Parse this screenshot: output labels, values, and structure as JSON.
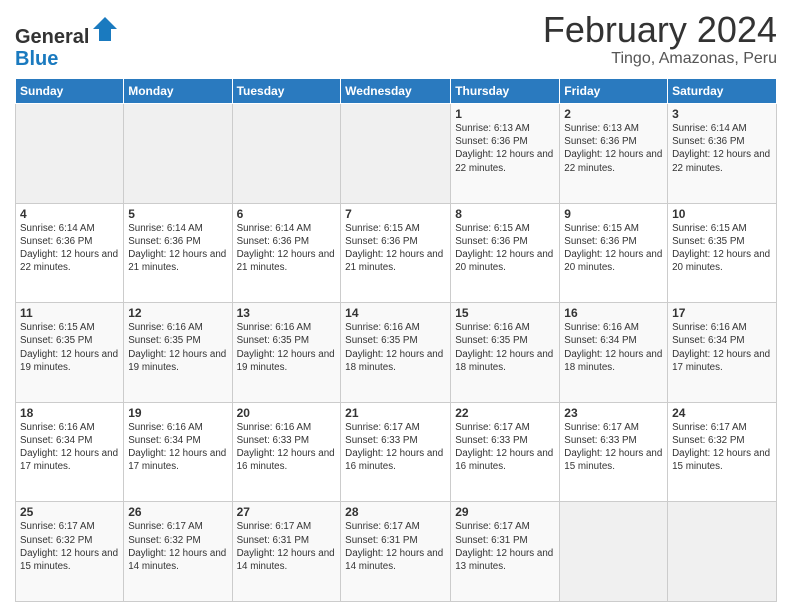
{
  "header": {
    "logo_general": "General",
    "logo_blue": "Blue",
    "title": "February 2024",
    "subtitle": "Tingo, Amazonas, Peru"
  },
  "days_of_week": [
    "Sunday",
    "Monday",
    "Tuesday",
    "Wednesday",
    "Thursday",
    "Friday",
    "Saturday"
  ],
  "weeks": [
    [
      {
        "day": "",
        "info": ""
      },
      {
        "day": "",
        "info": ""
      },
      {
        "day": "",
        "info": ""
      },
      {
        "day": "",
        "info": ""
      },
      {
        "day": "1",
        "info": "Sunrise: 6:13 AM\nSunset: 6:36 PM\nDaylight: 12 hours and 22 minutes."
      },
      {
        "day": "2",
        "info": "Sunrise: 6:13 AM\nSunset: 6:36 PM\nDaylight: 12 hours and 22 minutes."
      },
      {
        "day": "3",
        "info": "Sunrise: 6:14 AM\nSunset: 6:36 PM\nDaylight: 12 hours and 22 minutes."
      }
    ],
    [
      {
        "day": "4",
        "info": "Sunrise: 6:14 AM\nSunset: 6:36 PM\nDaylight: 12 hours and 22 minutes."
      },
      {
        "day": "5",
        "info": "Sunrise: 6:14 AM\nSunset: 6:36 PM\nDaylight: 12 hours and 21 minutes."
      },
      {
        "day": "6",
        "info": "Sunrise: 6:14 AM\nSunset: 6:36 PM\nDaylight: 12 hours and 21 minutes."
      },
      {
        "day": "7",
        "info": "Sunrise: 6:15 AM\nSunset: 6:36 PM\nDaylight: 12 hours and 21 minutes."
      },
      {
        "day": "8",
        "info": "Sunrise: 6:15 AM\nSunset: 6:36 PM\nDaylight: 12 hours and 20 minutes."
      },
      {
        "day": "9",
        "info": "Sunrise: 6:15 AM\nSunset: 6:36 PM\nDaylight: 12 hours and 20 minutes."
      },
      {
        "day": "10",
        "info": "Sunrise: 6:15 AM\nSunset: 6:35 PM\nDaylight: 12 hours and 20 minutes."
      }
    ],
    [
      {
        "day": "11",
        "info": "Sunrise: 6:15 AM\nSunset: 6:35 PM\nDaylight: 12 hours and 19 minutes."
      },
      {
        "day": "12",
        "info": "Sunrise: 6:16 AM\nSunset: 6:35 PM\nDaylight: 12 hours and 19 minutes."
      },
      {
        "day": "13",
        "info": "Sunrise: 6:16 AM\nSunset: 6:35 PM\nDaylight: 12 hours and 19 minutes."
      },
      {
        "day": "14",
        "info": "Sunrise: 6:16 AM\nSunset: 6:35 PM\nDaylight: 12 hours and 18 minutes."
      },
      {
        "day": "15",
        "info": "Sunrise: 6:16 AM\nSunset: 6:35 PM\nDaylight: 12 hours and 18 minutes."
      },
      {
        "day": "16",
        "info": "Sunrise: 6:16 AM\nSunset: 6:34 PM\nDaylight: 12 hours and 18 minutes."
      },
      {
        "day": "17",
        "info": "Sunrise: 6:16 AM\nSunset: 6:34 PM\nDaylight: 12 hours and 17 minutes."
      }
    ],
    [
      {
        "day": "18",
        "info": "Sunrise: 6:16 AM\nSunset: 6:34 PM\nDaylight: 12 hours and 17 minutes."
      },
      {
        "day": "19",
        "info": "Sunrise: 6:16 AM\nSunset: 6:34 PM\nDaylight: 12 hours and 17 minutes."
      },
      {
        "day": "20",
        "info": "Sunrise: 6:16 AM\nSunset: 6:33 PM\nDaylight: 12 hours and 16 minutes."
      },
      {
        "day": "21",
        "info": "Sunrise: 6:17 AM\nSunset: 6:33 PM\nDaylight: 12 hours and 16 minutes."
      },
      {
        "day": "22",
        "info": "Sunrise: 6:17 AM\nSunset: 6:33 PM\nDaylight: 12 hours and 16 minutes."
      },
      {
        "day": "23",
        "info": "Sunrise: 6:17 AM\nSunset: 6:33 PM\nDaylight: 12 hours and 15 minutes."
      },
      {
        "day": "24",
        "info": "Sunrise: 6:17 AM\nSunset: 6:32 PM\nDaylight: 12 hours and 15 minutes."
      }
    ],
    [
      {
        "day": "25",
        "info": "Sunrise: 6:17 AM\nSunset: 6:32 PM\nDaylight: 12 hours and 15 minutes."
      },
      {
        "day": "26",
        "info": "Sunrise: 6:17 AM\nSunset: 6:32 PM\nDaylight: 12 hours and 14 minutes."
      },
      {
        "day": "27",
        "info": "Sunrise: 6:17 AM\nSunset: 6:31 PM\nDaylight: 12 hours and 14 minutes."
      },
      {
        "day": "28",
        "info": "Sunrise: 6:17 AM\nSunset: 6:31 PM\nDaylight: 12 hours and 14 minutes."
      },
      {
        "day": "29",
        "info": "Sunrise: 6:17 AM\nSunset: 6:31 PM\nDaylight: 12 hours and 13 minutes."
      },
      {
        "day": "",
        "info": ""
      },
      {
        "day": "",
        "info": ""
      }
    ]
  ]
}
